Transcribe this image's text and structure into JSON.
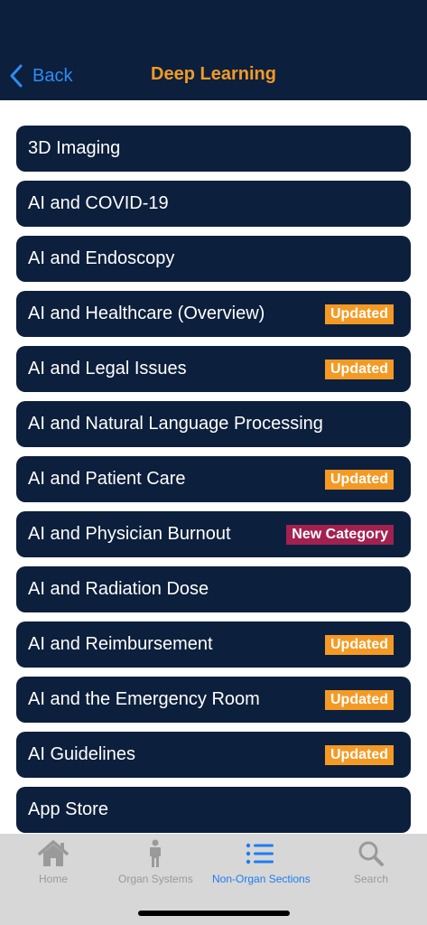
{
  "nav": {
    "back_label": "Back",
    "title": "Deep Learning"
  },
  "colors": {
    "nav_background": "#0c1f3c",
    "title_accent": "#f49a24",
    "link_blue": "#2f8cf5",
    "badge_updated": "#f49a24",
    "badge_new": "#a3214f",
    "tab_active": "#1f7cf0",
    "tab_inactive": "#9a9a9a"
  },
  "items": [
    {
      "label": "3D Imaging",
      "badge": ""
    },
    {
      "label": "AI and COVID-19",
      "badge": ""
    },
    {
      "label": "AI and Endoscopy",
      "badge": ""
    },
    {
      "label": "AI and Healthcare (Overview)",
      "badge": "Updated"
    },
    {
      "label": "AI and Legal Issues",
      "badge": "Updated"
    },
    {
      "label": "AI and Natural Language Processing",
      "badge": ""
    },
    {
      "label": "AI and Patient Care",
      "badge": "Updated"
    },
    {
      "label": "AI and Physician Burnout",
      "badge": "New Category"
    },
    {
      "label": "AI and Radiation Dose",
      "badge": ""
    },
    {
      "label": "AI and Reimbursement",
      "badge": "Updated"
    },
    {
      "label": "AI and the Emergency Room",
      "badge": "Updated"
    },
    {
      "label": "AI Guidelines",
      "badge": "Updated"
    },
    {
      "label": "App Store",
      "badge": ""
    }
  ],
  "tabs": [
    {
      "label": "Home",
      "icon": "house-icon",
      "active": false
    },
    {
      "label": "Organ Systems",
      "icon": "person-icon",
      "active": false
    },
    {
      "label": "Non-Organ Sections",
      "icon": "list-icon",
      "active": true
    },
    {
      "label": "Search",
      "icon": "magnifier-icon",
      "active": false
    }
  ]
}
